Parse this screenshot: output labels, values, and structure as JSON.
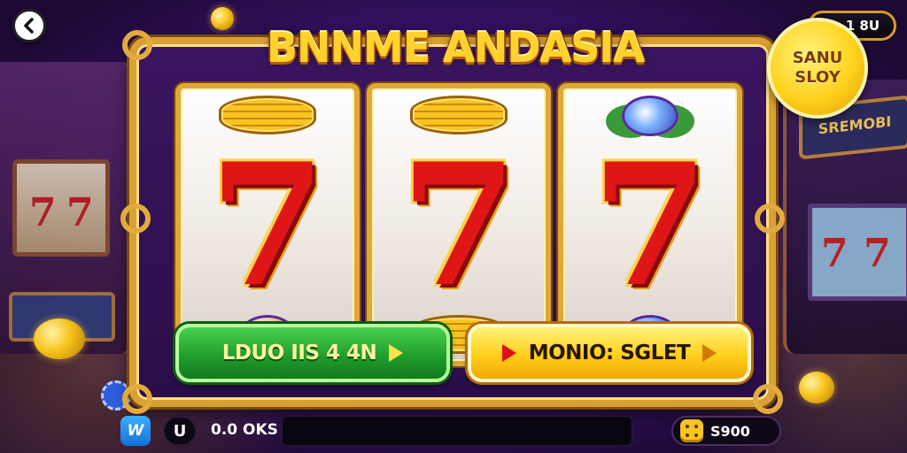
{
  "game": {
    "title": "BNNME ANDASIA",
    "top_badge": "1 8U",
    "corner_button": {
      "line1": "SANU",
      "line2": "SLOY"
    }
  },
  "reels": [
    {
      "top_symbol": "coins-icon",
      "main": "7",
      "bottom_symbol": "fruit-icon"
    },
    {
      "top_symbol": "coins-icon",
      "main": "7",
      "bottom_symbol": "coins-icon"
    },
    {
      "top_symbol": "gem-icon",
      "main": "7",
      "bottom_symbol": "gem-icon"
    }
  ],
  "buttons": {
    "green_label": "LDUO IIS 4 4N",
    "yellow_label": "MONIO: SGLET"
  },
  "bottom_bar": {
    "logo_text": "W",
    "icon_label": "U",
    "status_text": "0.0 OKS",
    "balance": "S900"
  },
  "colors": {
    "accent_gold": "#ffd22e",
    "frame_gold": "#d9a033",
    "seven_red": "#e01616",
    "green_button": "#1f9a2a",
    "yellow_button": "#ffcf1a",
    "background_purple": "#3d1470"
  }
}
